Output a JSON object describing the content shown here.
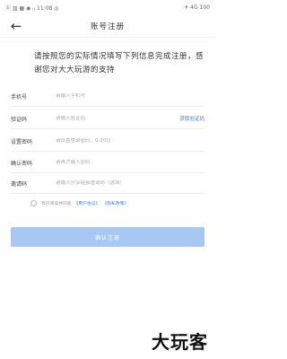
{
  "status_bar": {
    "left_text": "ⓑ ▥ ▦ ◉ ₍₍ 11:08 ◎",
    "right_text": "✈ 4G 100"
  },
  "header": {
    "back_icon": "arrow-left-icon",
    "title": "账号注册"
  },
  "intro": {
    "text": "请按照您的实际情况填写下列信息完成注册，感谢您对大大玩游的支持"
  },
  "form": {
    "fields": [
      {
        "label": "手机号",
        "placeholder": "请输入手机号"
      },
      {
        "label": "验证码",
        "placeholder": "请输入验证码",
        "action": "获取验证码"
      },
      {
        "label": "设置密码",
        "placeholder": "请设置登录密码，6-20位"
      },
      {
        "label": "确认密码",
        "placeholder": "请再次输入密码"
      },
      {
        "label": "邀请码",
        "placeholder": "请输入分享链接邀请码（选填）"
      }
    ]
  },
  "agreement": {
    "text": "我已阅读并同意",
    "user_agreement": "《用户协议》",
    "privacy_policy": "《隐私政策》"
  },
  "submit": {
    "label": "确认注册"
  },
  "watermark": {
    "text": "大玩客"
  }
}
